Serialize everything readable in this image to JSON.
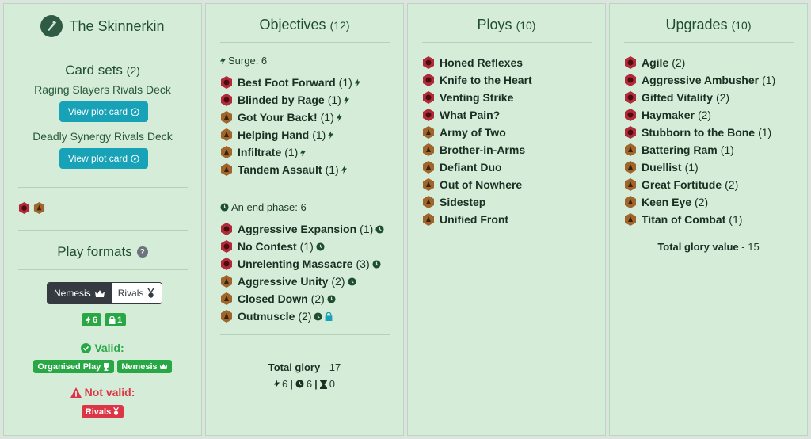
{
  "faction": {
    "name": "The Skinnerkin"
  },
  "colors": {
    "accent": "#17a2b8",
    "valid": "#28a745",
    "invalid": "#dc3545",
    "objective_icon_red": "#b02a37",
    "objective_icon_bronze": "#a0652b"
  },
  "card_sets": {
    "title": "Card sets",
    "count": "(2)",
    "decks": [
      {
        "name": "Raging Slayers Rivals Deck",
        "button": "View plot card"
      },
      {
        "name": "Deadly Synergy Rivals Deck",
        "button": "View plot card"
      }
    ]
  },
  "play_formats": {
    "title": "Play formats",
    "toggle": {
      "nemesis": "Nemesis",
      "rivals": "Rivals",
      "selected": "Nemesis"
    },
    "counts": {
      "surge": "6",
      "lock": "1"
    },
    "valid_label": "Valid:",
    "valid_badges": [
      "Organised Play",
      "Nemesis"
    ],
    "invalid_label": "Not valid:",
    "invalid_badges": [
      "Rivals"
    ]
  },
  "objectives": {
    "title": "Objectives",
    "count": "(12)",
    "surge_header": "Surge: 6",
    "surge": [
      {
        "name": "Best Foot Forward",
        "qty": "(1)",
        "icon": "red"
      },
      {
        "name": "Blinded by Rage",
        "qty": "(1)",
        "icon": "red"
      },
      {
        "name": "Got Your Back!",
        "qty": "(1)",
        "icon": "bronze"
      },
      {
        "name": "Helping Hand",
        "qty": "(1)",
        "icon": "bronze"
      },
      {
        "name": "Infiltrate",
        "qty": "(1)",
        "icon": "bronze"
      },
      {
        "name": "Tandem Assault",
        "qty": "(1)",
        "icon": "bronze"
      }
    ],
    "end_header": "An end phase: 6",
    "end": [
      {
        "name": "Aggressive Expansion",
        "qty": "(1)",
        "icon": "red"
      },
      {
        "name": "No Contest",
        "qty": "(1)",
        "icon": "red"
      },
      {
        "name": "Unrelenting Massacre",
        "qty": "(3)",
        "icon": "red"
      },
      {
        "name": "Aggressive Unity",
        "qty": "(2)",
        "icon": "bronze"
      },
      {
        "name": "Closed Down",
        "qty": "(2)",
        "icon": "bronze"
      },
      {
        "name": "Outmuscle",
        "qty": "(2)",
        "icon": "bronze",
        "locked": true
      }
    ],
    "total_label": "Total glory",
    "total_value": "- 17",
    "phase_counts": {
      "surge": "6",
      "end": "6",
      "third": "0"
    }
  },
  "ploys": {
    "title": "Ploys",
    "count": "(10)",
    "items": [
      {
        "name": "Honed Reflexes",
        "icon": "red"
      },
      {
        "name": "Knife to the Heart",
        "icon": "red"
      },
      {
        "name": "Venting Strike",
        "icon": "red"
      },
      {
        "name": "What Pain?",
        "icon": "red"
      },
      {
        "name": "Army of Two",
        "icon": "bronze"
      },
      {
        "name": "Brother-in-Arms",
        "icon": "bronze"
      },
      {
        "name": "Defiant Duo",
        "icon": "bronze"
      },
      {
        "name": "Out of Nowhere",
        "icon": "bronze"
      },
      {
        "name": "Sidestep",
        "icon": "bronze"
      },
      {
        "name": "Unified Front",
        "icon": "bronze"
      }
    ]
  },
  "upgrades": {
    "title": "Upgrades",
    "count": "(10)",
    "items": [
      {
        "name": "Agile",
        "qty": "(2)",
        "icon": "red"
      },
      {
        "name": "Aggressive Ambusher",
        "qty": "(1)",
        "icon": "red"
      },
      {
        "name": "Gifted Vitality",
        "qty": "(2)",
        "icon": "red"
      },
      {
        "name": "Haymaker",
        "qty": "(2)",
        "icon": "red"
      },
      {
        "name": "Stubborn to the Bone",
        "qty": "(1)",
        "icon": "red"
      },
      {
        "name": "Battering Ram",
        "qty": "(1)",
        "icon": "bronze"
      },
      {
        "name": "Duellist",
        "qty": "(1)",
        "icon": "bronze"
      },
      {
        "name": "Great Fortitude",
        "qty": "(2)",
        "icon": "bronze"
      },
      {
        "name": "Keen Eye",
        "qty": "(2)",
        "icon": "bronze"
      },
      {
        "name": "Titan of Combat",
        "qty": "(1)",
        "icon": "bronze"
      }
    ],
    "total_label": "Total glory value",
    "total_value": "- 15"
  }
}
